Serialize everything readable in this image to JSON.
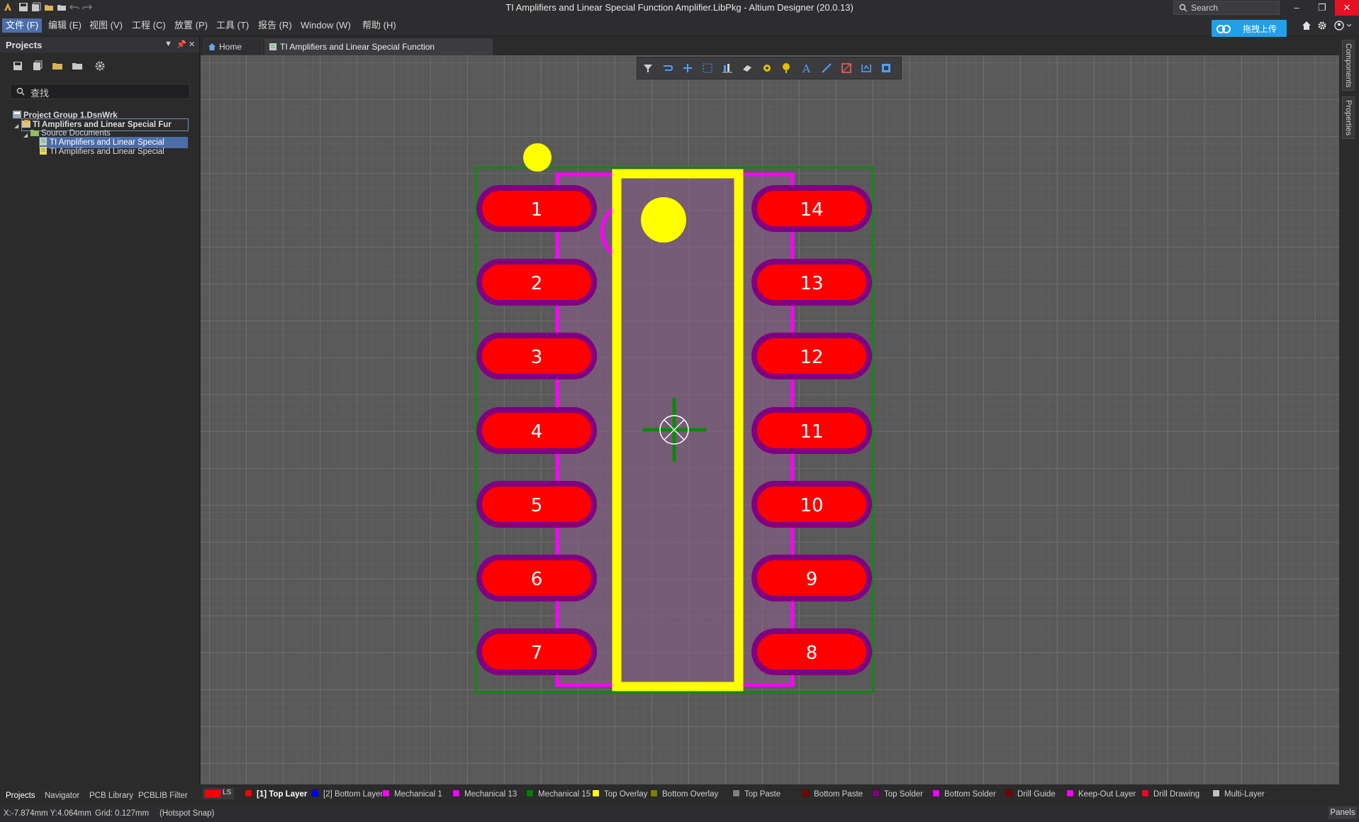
{
  "window": {
    "title": "TI Amplifiers and Linear Special Function Amplifier.LibPkg - Altium Designer (20.0.13)",
    "search_placeholder": "Search",
    "minimize": "–",
    "restore": "❐",
    "close": "✕"
  },
  "menu": {
    "items": [
      "文件 (F)",
      "编辑 (E)",
      "视图 (V)",
      "工程 (C)",
      "放置 (P)",
      "工具 (T)",
      "报告 (R)",
      "Window (W)",
      "帮助 (H)"
    ],
    "upload_label": "拖拽上传"
  },
  "projects_panel": {
    "title": "Projects",
    "find_placeholder": "查找",
    "tree": [
      {
        "label": "Project Group 1.DsnWrk"
      },
      {
        "label": "TI Amplifiers and Linear Special Fur"
      },
      {
        "label": "Source Documents"
      },
      {
        "label": "TI Amplifiers and Linear Special"
      },
      {
        "label": "TI Amplifiers and Linear Special"
      }
    ],
    "bottom_tabs": [
      "Projects",
      "Navigator",
      "PCB Library",
      "PCBLIB Filter"
    ]
  },
  "doc_tabs": [
    {
      "label": "Home Page"
    },
    {
      "label": "TI Amplifiers and Linear Special Function Amplifier.PcbLib"
    }
  ],
  "right_panels": [
    "Components",
    "Properties"
  ],
  "footprint": {
    "left_pads": [
      "1",
      "2",
      "3",
      "4",
      "5",
      "6",
      "7"
    ],
    "right_pads": [
      "14",
      "13",
      "12",
      "11",
      "10",
      "9",
      "8"
    ]
  },
  "layer_tabs": {
    "ls_label": "LS",
    "items": [
      {
        "label": "[1] Top Layer",
        "color": "#ff0000",
        "active": true
      },
      {
        "label": "[2] Bottom Layer",
        "color": "#0000ff"
      },
      {
        "label": "Mechanical 1",
        "color": "#ff00ff"
      },
      {
        "label": "Mechanical 13",
        "color": "#ff00ff"
      },
      {
        "label": "Mechanical 15",
        "color": "#008000"
      },
      {
        "label": "Top Overlay",
        "color": "#ffff00"
      },
      {
        "label": "Bottom Overlay",
        "color": "#808000"
      },
      {
        "label": "Top Paste",
        "color": "#808080"
      },
      {
        "label": "Bottom Paste",
        "color": "#800000"
      },
      {
        "label": "Top Solder",
        "color": "#800080"
      },
      {
        "label": "Bottom Solder",
        "color": "#ff00ff"
      },
      {
        "label": "Drill Guide",
        "color": "#800000"
      },
      {
        "label": "Keep-Out Layer",
        "color": "#ff00ff"
      },
      {
        "label": "Drill Drawing",
        "color": "#ff002a"
      },
      {
        "label": "Multi-Layer",
        "color": "#c0c0c0"
      }
    ]
  },
  "status": {
    "coords": "X:-7.874mm Y:4.064mm",
    "grid": "Grid: 0.127mm",
    "snap": "(Hotspot Snap)",
    "panels_button": "Panels"
  },
  "colors": {
    "accent": "#4b6ea9",
    "pad": "#ff0000",
    "solder_mask": "#800080",
    "overlay": "#ffff00",
    "mechanical": "#ff00ff",
    "outline": "#008000"
  }
}
